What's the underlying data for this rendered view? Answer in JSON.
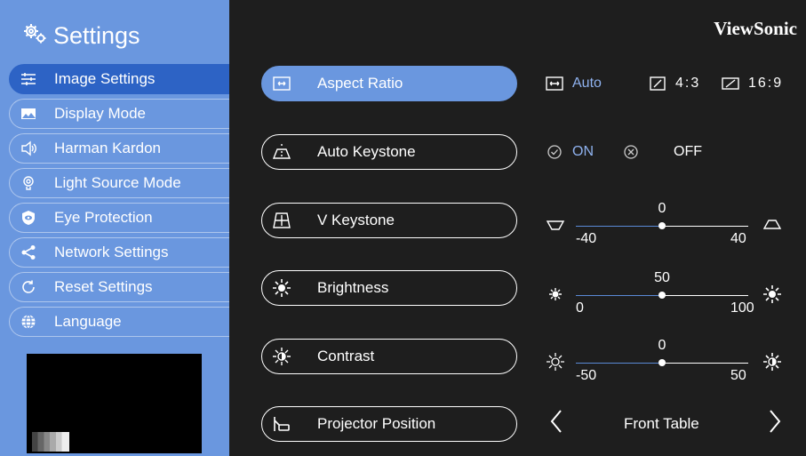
{
  "sidebar": {
    "title": "Settings",
    "items": [
      {
        "label": "Image Settings",
        "icon": "sliders-icon"
      },
      {
        "label": "Display Mode",
        "icon": "image-icon"
      },
      {
        "label": "Harman Kardon",
        "icon": "speaker-icon"
      },
      {
        "label": "Light Source Mode",
        "icon": "lamp-icon"
      },
      {
        "label": "Eye Protection",
        "icon": "eye-shield-icon"
      },
      {
        "label": "Network Settings",
        "icon": "share-icon"
      },
      {
        "label": "Reset Settings",
        "icon": "refresh-icon"
      },
      {
        "label": "Language",
        "icon": "globe-icon"
      }
    ]
  },
  "brand": "ViewSonic",
  "menu": [
    {
      "label": "Aspect Ratio",
      "icon": "aspect-ratio-icon"
    },
    {
      "label": "Auto Keystone",
      "icon": "auto-keystone-icon"
    },
    {
      "label": "V Keystone",
      "icon": "v-keystone-icon"
    },
    {
      "label": "Brightness",
      "icon": "brightness-icon"
    },
    {
      "label": "Contrast",
      "icon": "contrast-icon"
    },
    {
      "label": "Projector Position",
      "icon": "projector-position-icon"
    }
  ],
  "aspect": {
    "auto": "Auto",
    "r43": "4:3",
    "r169": "16:9"
  },
  "auto_keystone": {
    "on": "ON",
    "off": "OFF"
  },
  "v_keystone": {
    "value": "0",
    "min": "-40",
    "max": "40",
    "num": 0,
    "lo": -40,
    "hi": 40
  },
  "brightness": {
    "value": "50",
    "min": "0",
    "max": "100",
    "num": 50,
    "lo": 0,
    "hi": 100
  },
  "contrast": {
    "value": "0",
    "min": "-50",
    "max": "50",
    "num": 0,
    "lo": -50,
    "hi": 50
  },
  "projector_position": {
    "value": "Front Table"
  },
  "colors": {
    "sidebar": "#6a97df",
    "active": "#2d63c5",
    "accent": "#8fb2ef",
    "background": "#1e1e1e"
  }
}
